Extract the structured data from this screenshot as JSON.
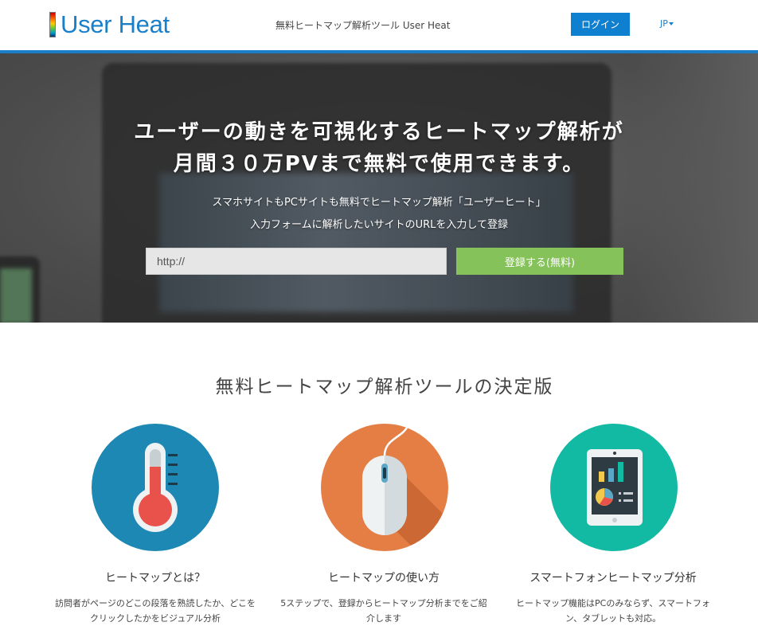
{
  "header": {
    "logo_text": "User Heat",
    "tagline": "無料ヒートマップ解析ツール User Heat",
    "login_label": "ログイン",
    "lang_label": "JP"
  },
  "hero": {
    "title_line1": "ユーザーの動きを可視化するヒートマップ解析が",
    "title_line2": "月間３０万PVまで無料で使用できます。",
    "sub_line1": "スマホサイトもPCサイトも無料でヒートマップ解析「ユーザーヒート」",
    "sub_line2": "入力フォームに解析したいサイトのURLを入力して登録",
    "url_placeholder": "http://",
    "register_label": "登録する(無料)"
  },
  "features": {
    "section_title": "無料ヒートマップ解析ツールの決定版",
    "items": [
      {
        "icon": "thermometer-icon",
        "title": "ヒートマップとは？",
        "desc": "訪問者がページのどこの段落を熟読したか、どこをクリックしたかをビジュアル分析"
      },
      {
        "icon": "mouse-icon",
        "title": "ヒートマップの使い方",
        "desc": "5ステップで、登録からヒートマップ分析までをご紹介します"
      },
      {
        "icon": "tablet-chart-icon",
        "title": "スマートフォンヒートマップ分析",
        "desc": "ヒートマップ機能はPCのみならず、スマートフォン、タブレットも対応。"
      }
    ]
  },
  "colors": {
    "brand_blue": "#1a7fc9",
    "register_green": "#86c25a",
    "feature1_bg": "#1e88b4",
    "feature2_bg": "#e57e45",
    "feature3_bg": "#12b9a3"
  }
}
